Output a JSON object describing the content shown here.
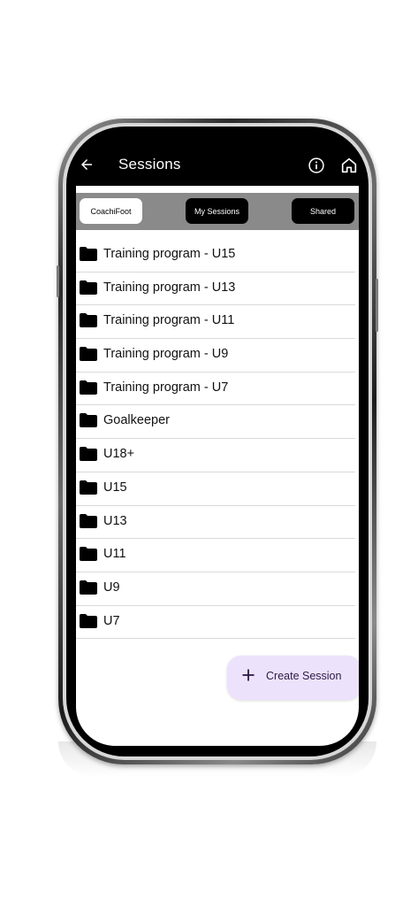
{
  "appbar": {
    "title": "Sessions",
    "back_icon": "arrow-left-icon",
    "info_icon": "info-circle-icon",
    "home_icon": "home-icon"
  },
  "tabs": [
    {
      "label": "CoachiFoot",
      "selected": true
    },
    {
      "label": "My Sessions",
      "selected": false
    },
    {
      "label": "Shared",
      "selected": false
    }
  ],
  "folders": [
    {
      "label": "Training program - U15",
      "icon": "folder-icon"
    },
    {
      "label": "Training program - U13",
      "icon": "folder-icon"
    },
    {
      "label": "Training program - U11",
      "icon": "folder-icon"
    },
    {
      "label": "Training program - U9",
      "icon": "folder-icon"
    },
    {
      "label": "Training program - U7",
      "icon": "folder-icon"
    },
    {
      "label": "Goalkeeper",
      "icon": "folder-icon"
    },
    {
      "label": "U18+",
      "icon": "folder-icon"
    },
    {
      "label": "U15",
      "icon": "folder-icon"
    },
    {
      "label": "U13",
      "icon": "folder-icon"
    },
    {
      "label": "U11",
      "icon": "folder-icon"
    },
    {
      "label": "U9",
      "icon": "folder-icon"
    },
    {
      "label": "U7",
      "icon": "folder-icon"
    }
  ],
  "fab": {
    "label": "Create Session",
    "icon": "plus-icon"
  },
  "colors": {
    "appbar_bg": "#000000",
    "tabs_bar_bg": "#8a8a8a",
    "tab_selected_bg": "#ffffff",
    "tab_unselected_bg": "#000000",
    "fab_bg": "#ede2fb",
    "fab_text": "#2a1b47"
  }
}
